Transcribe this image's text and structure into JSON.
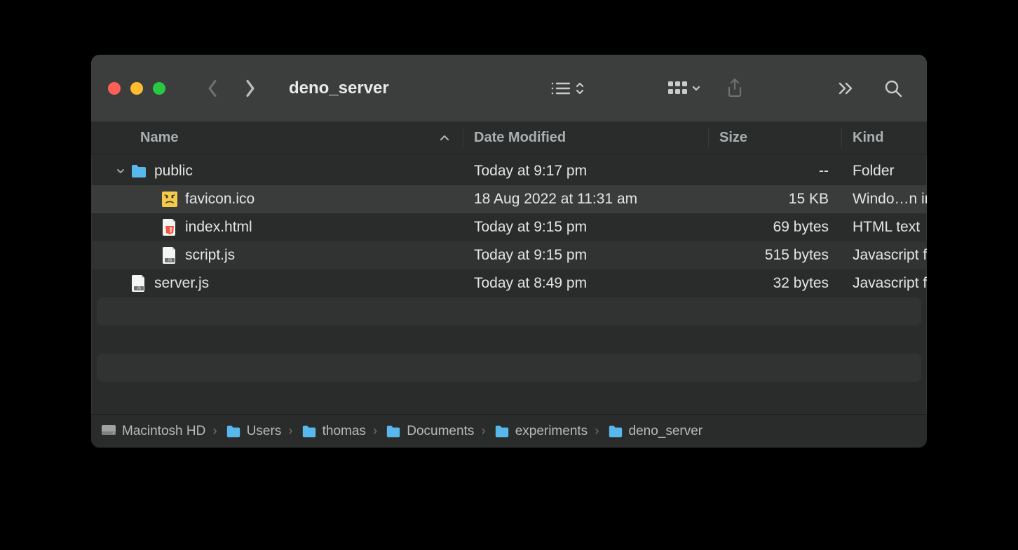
{
  "window": {
    "title": "deno_server"
  },
  "columns": {
    "name": "Name",
    "date": "Date Modified",
    "size": "Size",
    "kind": "Kind"
  },
  "rows": [
    {
      "icon": "folder",
      "indent": 0,
      "disclosure": "open",
      "name": "public",
      "date": "Today at 9:17 pm",
      "size": "--",
      "kind": "Folder",
      "alt": false,
      "selected": false
    },
    {
      "icon": "favicon",
      "indent": 1,
      "disclosure": "none",
      "name": "favicon.ico",
      "date": "18 Aug 2022 at 11:31 am",
      "size": "15 KB",
      "kind": "Windo…n image",
      "alt": true,
      "selected": true
    },
    {
      "icon": "html",
      "indent": 1,
      "disclosure": "none",
      "name": "index.html",
      "date": "Today at 9:15 pm",
      "size": "69 bytes",
      "kind": "HTML text",
      "alt": false,
      "selected": false
    },
    {
      "icon": "js",
      "indent": 1,
      "disclosure": "none",
      "name": "script.js",
      "date": "Today at 9:15 pm",
      "size": "515 bytes",
      "kind": "Javascript file",
      "alt": true,
      "selected": false
    },
    {
      "icon": "js",
      "indent": 0,
      "disclosure": "none",
      "name": "server.js",
      "date": "Today at 8:49 pm",
      "size": "32 bytes",
      "kind": "Javascript file",
      "alt": false,
      "selected": false
    }
  ],
  "path": [
    {
      "icon": "hd",
      "label": "Macintosh HD"
    },
    {
      "icon": "folder",
      "label": "Users"
    },
    {
      "icon": "folder",
      "label": "thomas"
    },
    {
      "icon": "folder",
      "label": "Documents"
    },
    {
      "icon": "folder",
      "label": "experiments"
    },
    {
      "icon": "folder",
      "label": "deno_server"
    }
  ]
}
